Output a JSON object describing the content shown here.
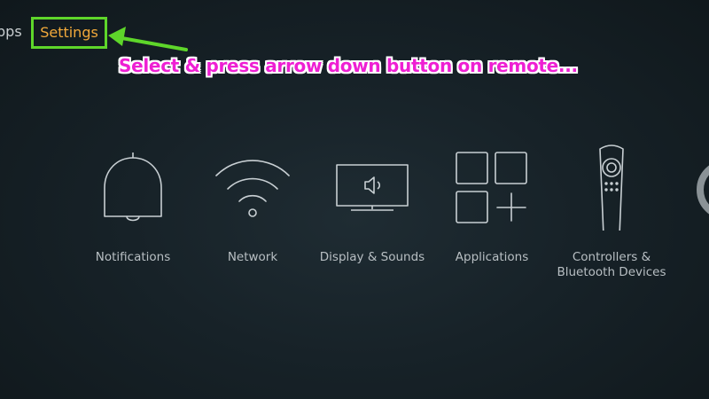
{
  "topnav": {
    "apps_label": "pps",
    "settings_label": "Settings"
  },
  "annotation": {
    "text": "Select & press arrow down button on remote..."
  },
  "tiles": [
    {
      "label": "Notifications",
      "icon": "bell-icon"
    },
    {
      "label": "Network",
      "icon": "wifi-icon"
    },
    {
      "label": "Display & Sounds",
      "icon": "monitor-speaker-icon"
    },
    {
      "label": "Applications",
      "icon": "apps-grid-icon"
    },
    {
      "label": "Controllers &\nBluetooth Devices",
      "icon": "remote-icon"
    }
  ],
  "colors": {
    "selected_text": "#f2a93b",
    "highlight_border": "#5ed62a",
    "annotation_text": "#ee1fd3"
  }
}
